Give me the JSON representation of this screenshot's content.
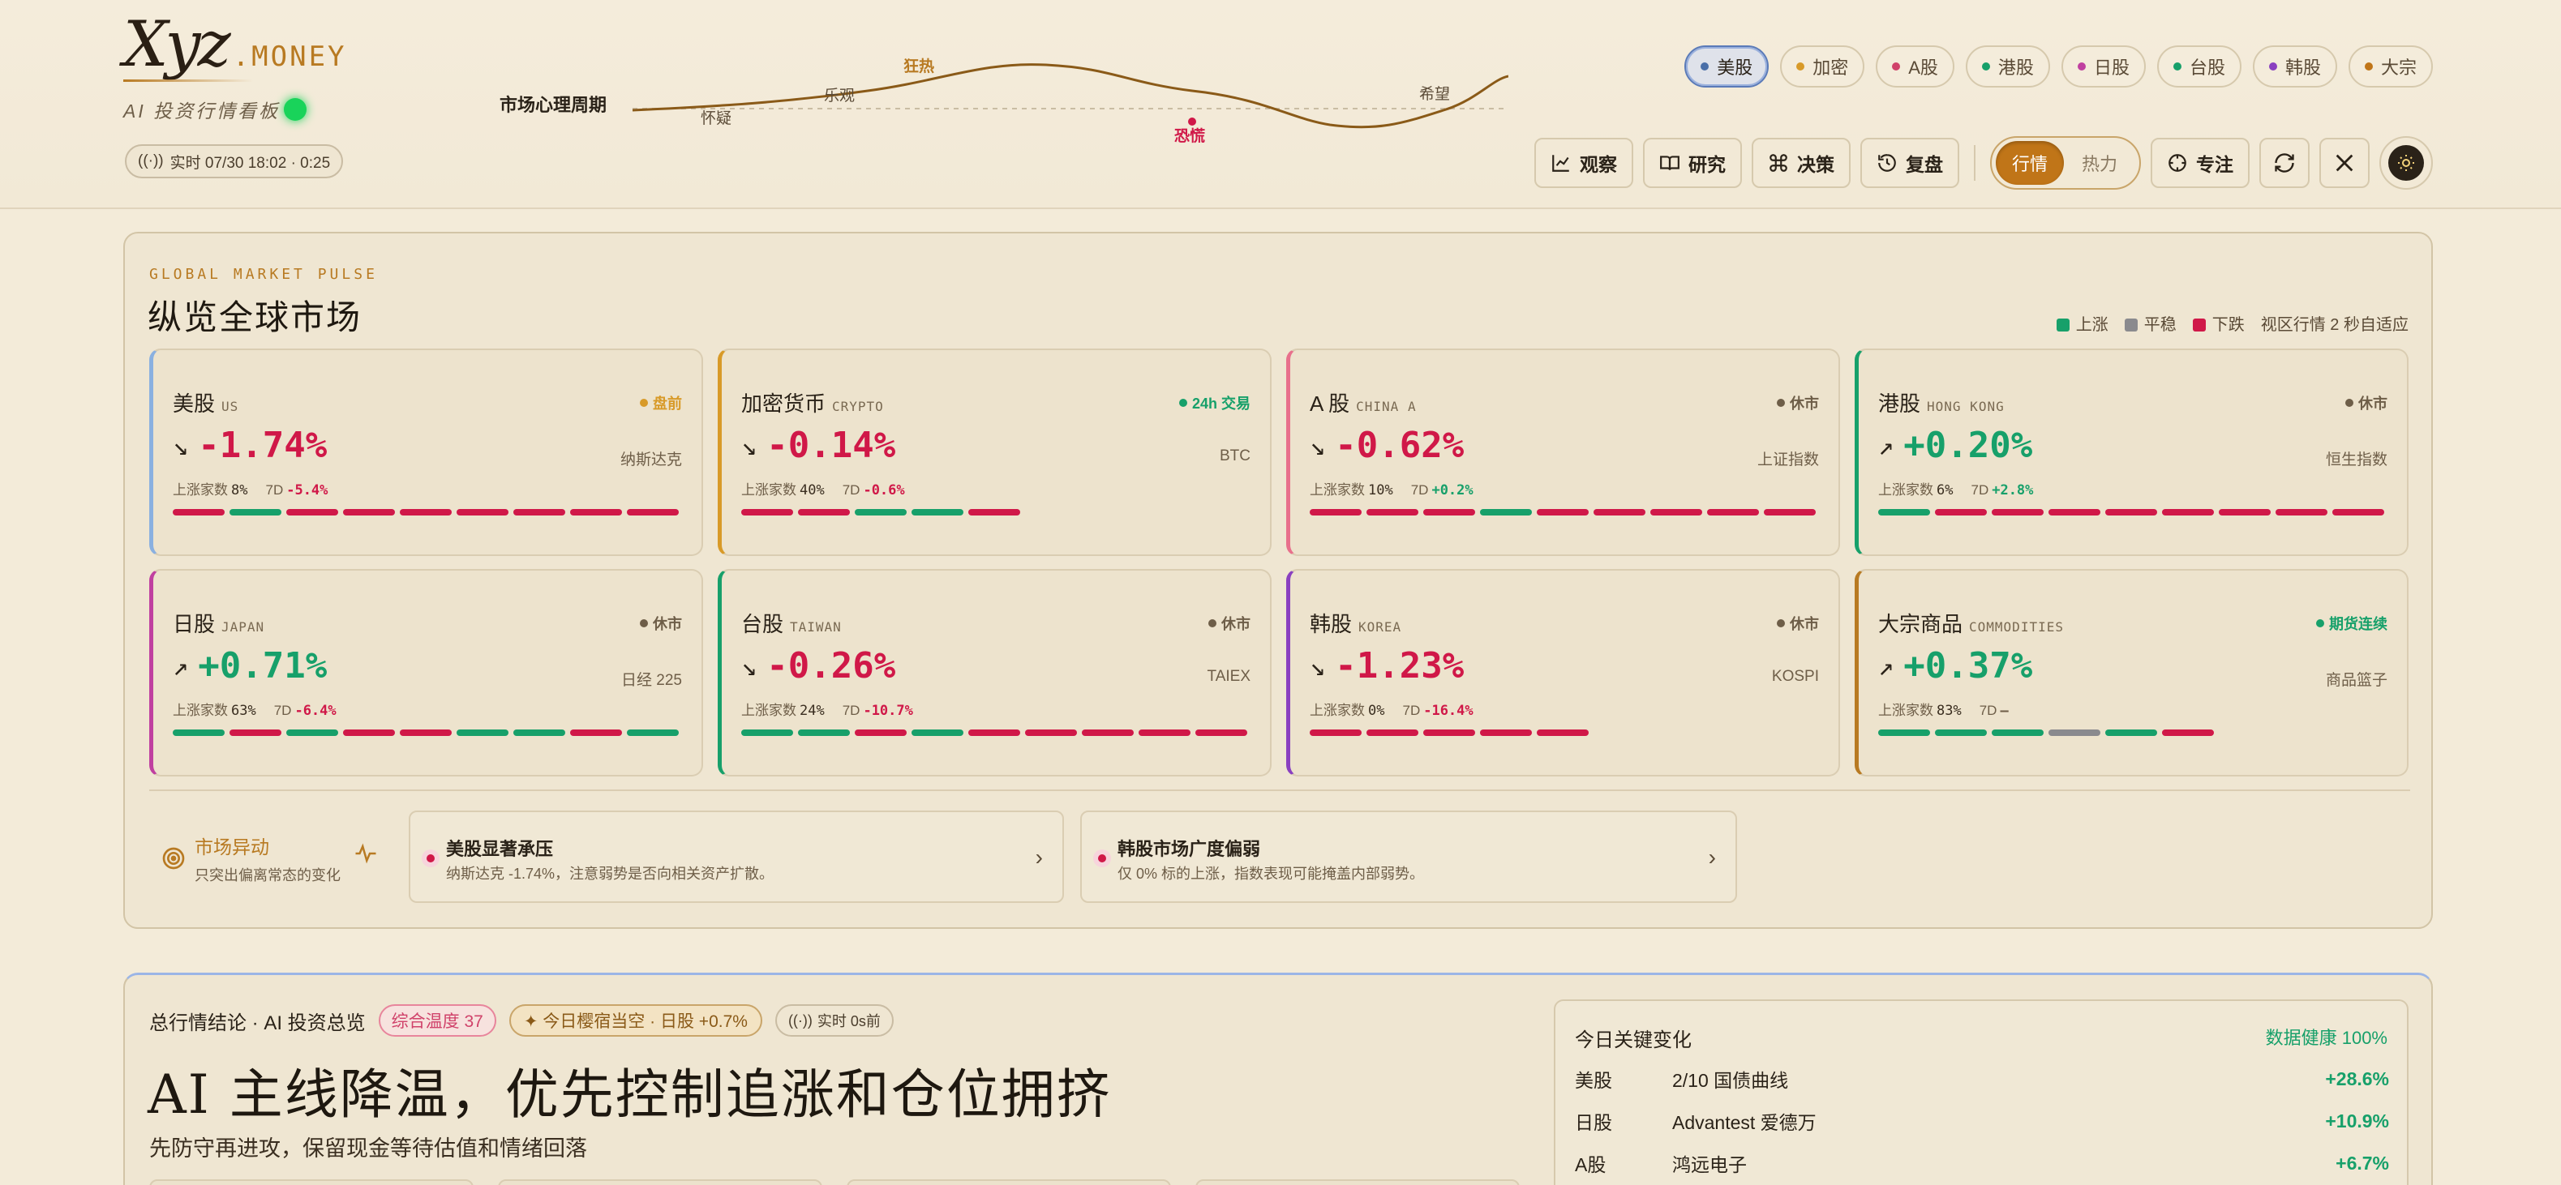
{
  "brand": {
    "name": "Xyz",
    "suffix": ".MONEY",
    "tagline": "AI 投资行情看板"
  },
  "live_status": {
    "text": "实时 07/30 18:02 · 0:25"
  },
  "cycle": {
    "label": "市场心理周期",
    "phases": [
      "怀疑",
      "乐观",
      "狂热",
      "恐慌",
      "希望"
    ],
    "current": "恐慌"
  },
  "market_chips": [
    {
      "label": "美股",
      "color": "#4a6fa8",
      "active": true
    },
    {
      "label": "加密",
      "color": "#d89a28",
      "active": false
    },
    {
      "label": "A股",
      "color": "#d0426a",
      "active": false
    },
    {
      "label": "港股",
      "color": "#17a06a",
      "active": false
    },
    {
      "label": "日股",
      "color": "#c040a0",
      "active": false
    },
    {
      "label": "台股",
      "color": "#17a06a",
      "active": false
    },
    {
      "label": "韩股",
      "color": "#8a40c0",
      "active": false
    },
    {
      "label": "大宗",
      "color": "#c07518",
      "active": false
    }
  ],
  "toolbar": {
    "observe": "观察",
    "research": "研究",
    "decide": "决策",
    "review": "复盘",
    "toggle_on": "行情",
    "toggle_off": "热力",
    "focus": "专注"
  },
  "icons": [
    "chart-line-icon",
    "book-icon",
    "command-icon",
    "history-icon",
    "focus-icon",
    "refresh-icon",
    "x-icon",
    "sun-icon"
  ],
  "pulse": {
    "kicker": "GLOBAL MARKET PULSE",
    "title": "纵览全球市场",
    "legend": {
      "up": "上涨",
      "flat": "平稳",
      "down": "下跌",
      "note": "视区行情  2  秒自适应"
    }
  },
  "colors": {
    "up": "#17a06a",
    "down": "#d01848",
    "flat": "#8a8a8e",
    "brand": "#b87a22"
  },
  "markets": [
    {
      "name": "美股",
      "en": "US",
      "status": "盘前",
      "status_color": "#d89a28",
      "arrow": "↘",
      "pct": "-1.74%",
      "dir": "down",
      "index": "纳斯达克",
      "breadth_label": "上涨家数",
      "breadth": "8%",
      "seven_label": "7D",
      "seven": "-5.4%",
      "seven_dir": "down",
      "accent": "#8ab0e0",
      "bars": [
        "d",
        "u",
        "d",
        "d",
        "d",
        "d",
        "d",
        "d",
        "d"
      ]
    },
    {
      "name": "加密货币",
      "en": "CRYPTO",
      "status": "24h 交易",
      "status_color": "#17a06a",
      "arrow": "↘",
      "pct": "-0.14%",
      "dir": "down",
      "index": "BTC",
      "breadth_label": "上涨家数",
      "breadth": "40%",
      "seven_label": "7D",
      "seven": "-0.6%",
      "seven_dir": "down",
      "accent": "#d89a28",
      "bars": [
        "d",
        "d",
        "u",
        "u",
        "d"
      ]
    },
    {
      "name": "A 股",
      "en": "CHINA A",
      "status": "休市",
      "status_color": "#6e5e48",
      "arrow": "↘",
      "pct": "-0.62%",
      "dir": "down",
      "index": "上证指数",
      "breadth_label": "上涨家数",
      "breadth": "10%",
      "seven_label": "7D",
      "seven": "+0.2%",
      "seven_dir": "up",
      "accent": "#e8708c",
      "bars": [
        "d",
        "d",
        "d",
        "u",
        "d",
        "d",
        "d",
        "d",
        "d"
      ]
    },
    {
      "name": "港股",
      "en": "HONG KONG",
      "status": "休市",
      "status_color": "#6e5e48",
      "arrow": "↗",
      "pct": "+0.20%",
      "dir": "up",
      "index": "恒生指数",
      "breadth_label": "上涨家数",
      "breadth": "6%",
      "seven_label": "7D",
      "seven": "+2.8%",
      "seven_dir": "up",
      "accent": "#17a06a",
      "bars": [
        "u",
        "d",
        "d",
        "d",
        "d",
        "d",
        "d",
        "d",
        "d"
      ]
    },
    {
      "name": "日股",
      "en": "JAPAN",
      "status": "休市",
      "status_color": "#6e5e48",
      "arrow": "↗",
      "pct": "+0.71%",
      "dir": "up",
      "index": "日经 225",
      "breadth_label": "上涨家数",
      "breadth": "63%",
      "seven_label": "7D",
      "seven": "-6.4%",
      "seven_dir": "down",
      "accent": "#c040a0",
      "bars": [
        "u",
        "d",
        "u",
        "d",
        "d",
        "u",
        "u",
        "d",
        "u"
      ]
    },
    {
      "name": "台股",
      "en": "TAIWAN",
      "status": "休市",
      "status_color": "#6e5e48",
      "arrow": "↘",
      "pct": "-0.26%",
      "dir": "down",
      "index": "TAIEX",
      "breadth_label": "上涨家数",
      "breadth": "24%",
      "seven_label": "7D",
      "seven": "-10.7%",
      "seven_dir": "down",
      "accent": "#17a06a",
      "bars": [
        "u",
        "u",
        "d",
        "u",
        "d",
        "d",
        "d",
        "d",
        "d"
      ]
    },
    {
      "name": "韩股",
      "en": "KOREA",
      "status": "休市",
      "status_color": "#6e5e48",
      "arrow": "↘",
      "pct": "-1.23%",
      "dir": "down",
      "index": "KOSPI",
      "breadth_label": "上涨家数",
      "breadth": "0%",
      "seven_label": "7D",
      "seven": "-16.4%",
      "seven_dir": "down",
      "accent": "#8a40c0",
      "bars": [
        "d",
        "d",
        "d",
        "d",
        "d"
      ]
    },
    {
      "name": "大宗商品",
      "en": "COMMODITIES",
      "status": "期货连续",
      "status_color": "#17a06a",
      "arrow": "↗",
      "pct": "+0.37%",
      "dir": "up",
      "index": "商品篮子",
      "breadth_label": "上涨家数",
      "breadth": "83%",
      "seven_label": "7D",
      "seven": "—",
      "seven_dir": "flat",
      "accent": "#b87a22",
      "bars": [
        "u",
        "u",
        "u",
        "f",
        "u",
        "d"
      ]
    }
  ],
  "movers": {
    "title": "市场异动",
    "sub": "只突出偏离常态的变化"
  },
  "alerts": [
    {
      "title": "美股显著承压",
      "desc": "纳斯达克 -1.74%，注意弱势是否向相关资产扩散。"
    },
    {
      "title": "韩股市场广度偏弱",
      "desc": "仅 0% 标的上涨，指数表现可能掩盖内部弱势。"
    }
  ],
  "summary": {
    "label": "总行情结论 · AI 投资总览",
    "temp_tag": "综合温度 37",
    "star_tag": "✦ 今日樱宿当空 · 日股 +0.7%",
    "live_tag": "实时 0s前",
    "headline": "AI 主线降温，优先控制追涨和仓位拥挤",
    "sub": "先防守再进攻，保留现金等待估值和情绪回落"
  },
  "changes": {
    "title": "今日关键变化",
    "health": "数据健康 100%",
    "rows": [
      {
        "market": "美股",
        "target": "2/10 国债曲线",
        "pct": "+28.6%"
      },
      {
        "market": "日股",
        "target": "Advantest 爱德万",
        "pct": "+10.9%"
      },
      {
        "market": "A股",
        "target": "鸿远电子",
        "pct": "+6.7%"
      }
    ]
  }
}
